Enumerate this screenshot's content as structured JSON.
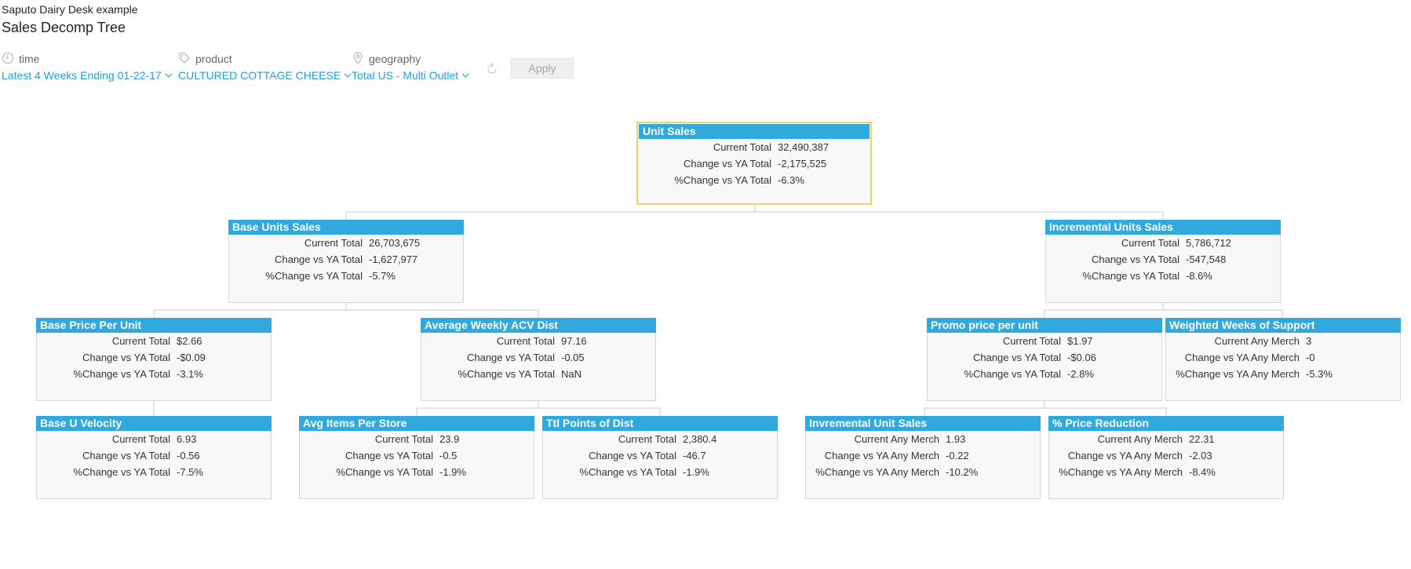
{
  "header": {
    "app_subtitle": "Saputo Dairy Desk example",
    "title": "Sales Decomp Tree"
  },
  "filters": {
    "time": {
      "label": "time",
      "value": "Latest 4 Weeks Ending 01-22-17",
      "icon": "clock-icon"
    },
    "product": {
      "label": "product",
      "value": "CULTURED COTTAGE CHEESE",
      "icon": "tag-icon"
    },
    "geography": {
      "label": "geography",
      "value": "Total US - Multi Outlet",
      "icon": "map-pin-icon"
    },
    "apply_label": "Apply"
  },
  "colors": {
    "accent": "#30a9df",
    "link": "#1ea0d9",
    "selected_border": "#f5d060",
    "node_bg": "#f8f8f8"
  },
  "tree": {
    "unit_sales": {
      "title": "Unit Sales",
      "rows": [
        {
          "label": "Current Total",
          "value": "32,490,387"
        },
        {
          "label": "Change vs YA Total",
          "value": "-2,175,525"
        },
        {
          "label": "%Change vs YA Total",
          "value": "-6.3%"
        }
      ]
    },
    "base_units_sales": {
      "title": "Base Units Sales",
      "rows": [
        {
          "label": "Current Total",
          "value": "26,703,675"
        },
        {
          "label": "Change vs YA Total",
          "value": "-1,627,977"
        },
        {
          "label": "%Change vs YA Total",
          "value": "-5.7%"
        }
      ]
    },
    "incremental_units_sales": {
      "title": "Incremental Units Sales",
      "rows": [
        {
          "label": "Current Total",
          "value": "5,786,712"
        },
        {
          "label": "Change vs YA Total",
          "value": "-547,548"
        },
        {
          "label": "%Change vs YA Total",
          "value": "-8.6%"
        }
      ]
    },
    "base_price_per_unit": {
      "title": "Base Price Per Unit",
      "rows": [
        {
          "label": "Current Total",
          "value": "$2.66"
        },
        {
          "label": "Change vs YA Total",
          "value": "-$0.09"
        },
        {
          "label": "%Change vs YA Total",
          "value": "-3.1%"
        }
      ]
    },
    "average_weekly_acv_dist": {
      "title": "Average Weekly ACV Dist",
      "rows": [
        {
          "label": "Current Total",
          "value": "97.16"
        },
        {
          "label": "Change vs YA Total",
          "value": "-0.05"
        },
        {
          "label": "%Change vs YA Total",
          "value": "NaN"
        }
      ]
    },
    "promo_price_per_unit": {
      "title": "Promo price per unit",
      "rows": [
        {
          "label": "Current Total",
          "value": "$1.97"
        },
        {
          "label": "Change vs YA Total",
          "value": "-$0.06"
        },
        {
          "label": "%Change vs YA Total",
          "value": "-2.8%"
        }
      ]
    },
    "weighted_weeks_of_support": {
      "title": "Weighted Weeks of Support",
      "rows": [
        {
          "label": "Current Any Merch",
          "value": "3"
        },
        {
          "label": "Change vs YA Any Merch",
          "value": "-0"
        },
        {
          "label": "%Change vs YA Any Merch",
          "value": "-5.3%"
        }
      ]
    },
    "base_u_velocity": {
      "title": "Base U Velocity",
      "rows": [
        {
          "label": "Current Total",
          "value": "6.93"
        },
        {
          "label": "Change vs YA Total",
          "value": "-0.56"
        },
        {
          "label": "%Change vs YA Total",
          "value": "-7.5%"
        }
      ]
    },
    "avg_items_per_store": {
      "title": "Avg Items Per Store",
      "rows": [
        {
          "label": "Current Total",
          "value": "23.9"
        },
        {
          "label": "Change vs YA Total",
          "value": "-0.5"
        },
        {
          "label": "%Change vs YA Total",
          "value": "-1.9%"
        }
      ]
    },
    "ttl_points_of_dist": {
      "title": "Ttl Points of Dist",
      "rows": [
        {
          "label": "Current Total",
          "value": "2,380.4"
        },
        {
          "label": "Change vs YA Total",
          "value": "-46.7"
        },
        {
          "label": "%Change vs YA Total",
          "value": "-1.9%"
        }
      ]
    },
    "invremental_unit_sales": {
      "title": "Invremental Unit Sales",
      "rows": [
        {
          "label": "Current Any Merch",
          "value": "1.93"
        },
        {
          "label": "Change vs YA Any Merch",
          "value": "-0.22"
        },
        {
          "label": "%Change vs YA Any Merch",
          "value": "-10.2%"
        }
      ]
    },
    "pct_price_reduction": {
      "title": "% Price Reduction",
      "rows": [
        {
          "label": "Current Any Merch",
          "value": "22.31"
        },
        {
          "label": "Change vs YA Any Merch",
          "value": "-2.03"
        },
        {
          "label": "%Change vs YA Any Merch",
          "value": "-8.4%"
        }
      ]
    }
  }
}
